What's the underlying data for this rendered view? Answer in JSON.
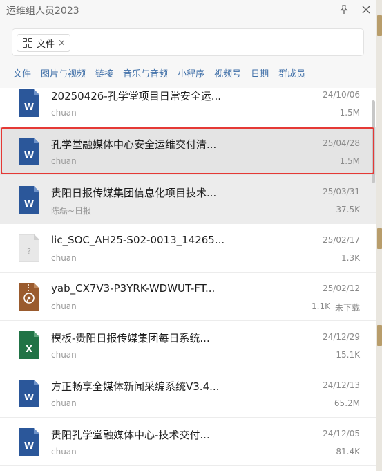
{
  "window": {
    "title": "运维组人员2023"
  },
  "search": {
    "chip_label": "文件",
    "chip_close": "×"
  },
  "tabs": [
    "文件",
    "图片与视频",
    "链接",
    "音乐与音频",
    "小程序",
    "视频号",
    "日期",
    "群成员"
  ],
  "icons": {
    "pin": "pin-icon",
    "close": "close-icon"
  },
  "colors": {
    "word": "#2b579a",
    "excel": "#217346",
    "unknown": "#e6e6e6",
    "archive": "#9a5b2e",
    "tab": "#3f6fa8",
    "selection": "#e53935"
  },
  "files": [
    {
      "name": "20250426-孔学堂项目日常安全运...",
      "source": "chuan",
      "date": "24/10/06",
      "size": "1.5M",
      "type": "word",
      "status": ""
    },
    {
      "name": "孔学堂融媒体中心安全运维交付清...",
      "source": "chuan",
      "date": "25/04/28",
      "size": "1.5M",
      "type": "word",
      "status": ""
    },
    {
      "name": "贵阳日报传媒集团信息化项目技术...",
      "source": "陈磊~日报",
      "date": "25/03/31",
      "size": "37.5K",
      "type": "word",
      "status": ""
    },
    {
      "name": "lic_SOC_AH25-S02-0013_14265...",
      "source": "chuan",
      "date": "25/02/17",
      "size": "1.3K",
      "type": "unknown",
      "status": ""
    },
    {
      "name": "yab_CX7V3-P3YRK-WDWUT-FT...",
      "source": "chuan",
      "date": "25/02/12",
      "size": "1.1K",
      "type": "archive",
      "status": "未下载"
    },
    {
      "name": "模板-贵阳日报传媒集团每日系统...",
      "source": "chuan",
      "date": "24/12/29",
      "size": "15.1K",
      "type": "excel",
      "status": ""
    },
    {
      "name": "方正畅享全媒体新闻采编系统V3.4...",
      "source": "chuan",
      "date": "24/12/13",
      "size": "65.2M",
      "type": "word",
      "status": ""
    },
    {
      "name": "贵阳孔学堂融媒体中心-技术交付...",
      "source": "chuan",
      "date": "24/12/05",
      "size": "81.4K",
      "type": "word",
      "status": ""
    }
  ]
}
